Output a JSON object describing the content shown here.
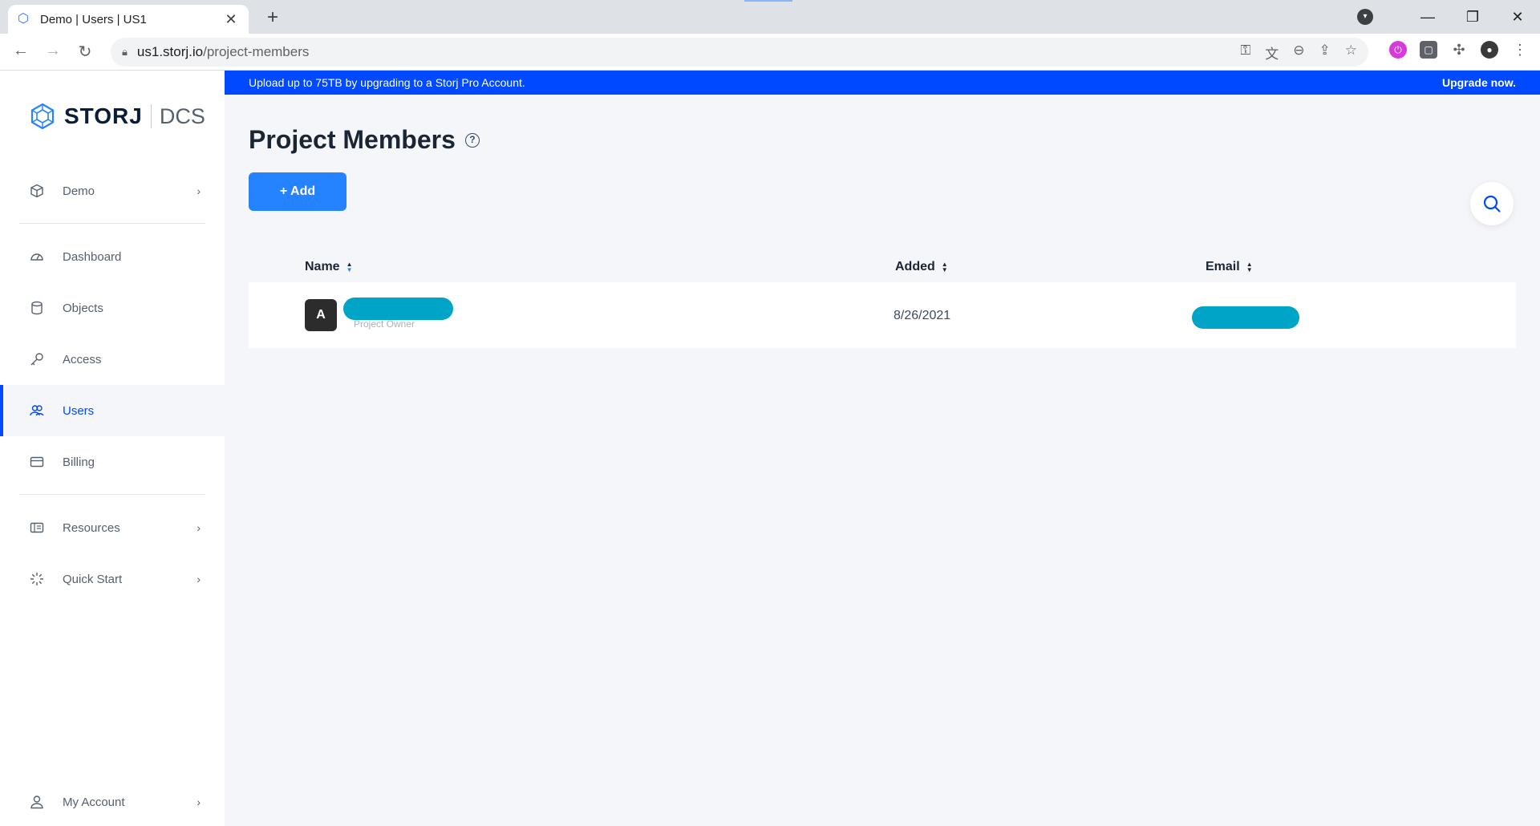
{
  "browser": {
    "tab_title": "Demo | Users | US1",
    "tab_close": "✕",
    "new_tab": "+",
    "url_host": "us1.storj.io",
    "url_path": "/project-members",
    "window_buttons": [
      "—",
      "❐",
      "✕"
    ]
  },
  "sidebar": {
    "brand": "STORJ",
    "product": "DCS",
    "project": {
      "label": "Demo",
      "icon": "cube-icon"
    },
    "items": [
      {
        "label": "Dashboard",
        "icon": "dashboard-icon"
      },
      {
        "label": "Objects",
        "icon": "objects-icon"
      },
      {
        "label": "Access",
        "icon": "key-icon"
      },
      {
        "label": "Users",
        "icon": "users-icon",
        "active": true
      },
      {
        "label": "Billing",
        "icon": "card-icon"
      }
    ],
    "secondary": [
      {
        "label": "Resources",
        "icon": "resources-icon"
      },
      {
        "label": "Quick Start",
        "icon": "sparkle-icon"
      }
    ],
    "account": {
      "label": "My Account",
      "icon": "user-icon"
    }
  },
  "banner": {
    "text": "Upload up to 75TB by upgrading to a Storj Pro Account.",
    "cta": "Upgrade now."
  },
  "main": {
    "title": "Project Members",
    "help": "?",
    "add_button": "+ Add",
    "columns": {
      "name": "Name",
      "added": "Added",
      "email": "Email"
    },
    "rows": [
      {
        "avatar_letter": "A",
        "role": "Project Owner",
        "added": "8/26/2021"
      }
    ]
  },
  "colors": {
    "accent": "#0149ff",
    "button": "#2683ff",
    "redaction": "#00a4c6"
  }
}
